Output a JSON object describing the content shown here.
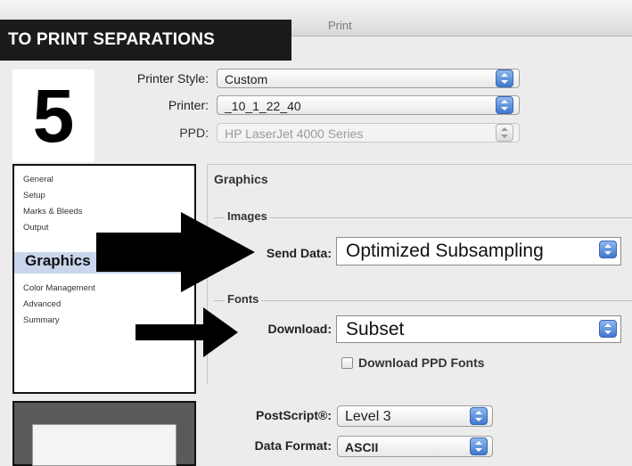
{
  "window": {
    "title": "Print"
  },
  "badge": {
    "text": "TO PRINT SEPARATIONS",
    "step": "5"
  },
  "printer_style": {
    "label": "Printer Style:",
    "value": "Custom"
  },
  "printer": {
    "label": "Printer:",
    "value": "_10_1_22_40"
  },
  "ppd": {
    "label": "PPD:",
    "value": "HP LaserJet 4000 Series"
  },
  "sidebar": {
    "items": [
      "General",
      "Setup",
      "Marks & Bleeds",
      "Output",
      "Graphics",
      "Color Management",
      "Advanced",
      "Summary"
    ],
    "selected": "Graphics"
  },
  "panel": {
    "title": "Graphics",
    "images": {
      "group": "Images",
      "label": "Send Data:",
      "value": "Optimized Subsampling"
    },
    "fonts": {
      "group": "Fonts",
      "label": "Download:",
      "value": "Subset",
      "checkbox_label": "Download PPD Fonts"
    },
    "postscript": {
      "label": "PostScript®:",
      "value": "Level 3"
    },
    "data_format": {
      "label": "Data Format:",
      "value": "ASCII"
    }
  },
  "colors": {
    "accent": "#3f78cf",
    "badge": "#1b1b1b",
    "selection": "#c9d6ec"
  }
}
